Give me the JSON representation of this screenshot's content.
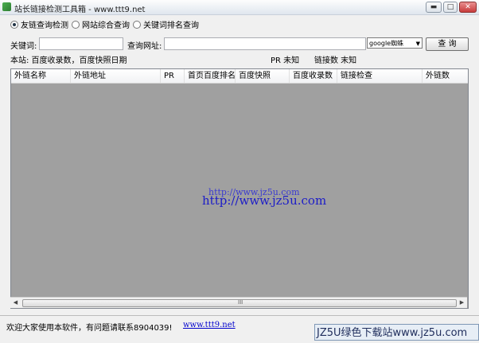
{
  "window": {
    "title": "站长链接检测工具箱 - www.ttt9.net",
    "min_glyph": "▬",
    "max_glyph": "□",
    "close_glyph": "✕"
  },
  "modes": [
    {
      "label": "友链查询检测",
      "checked": true
    },
    {
      "label": "网站综合查询",
      "checked": false
    },
    {
      "label": "关键词排名查询",
      "checked": false
    }
  ],
  "query": {
    "keyword_label": "关键词:",
    "keyword_value": "",
    "url_label": "查询网址:",
    "url_value": "",
    "engine_selected": "google蜘蛛",
    "query_button": "查 询"
  },
  "info": {
    "site_line": "本站: 百度收录数，百度快照日期",
    "pr_line": "PR 未知",
    "links_line": "链接数 末知"
  },
  "table": {
    "columns": [
      "外链名称",
      "外链地址",
      "PR",
      "首页百度排名",
      "百度快照",
      "百度收录数",
      "链接检查",
      "外链数"
    ],
    "rows": []
  },
  "watermark": {
    "line1": "http://www.jz5u.com",
    "line2": "http://www.jz5u.com"
  },
  "scrollbar": {
    "left_glyph": "◀",
    "right_glyph": "▶",
    "grip_glyph": "III"
  },
  "status": {
    "message": "欢迎大家使用本软件，有问题请联系8904039!",
    "link": "www.ttt9.net",
    "brand": "JZ5U绿色下载站www.jz5u.com"
  },
  "colors": {
    "grid_bg": "#a0a0a0",
    "link": "#0000cc"
  }
}
